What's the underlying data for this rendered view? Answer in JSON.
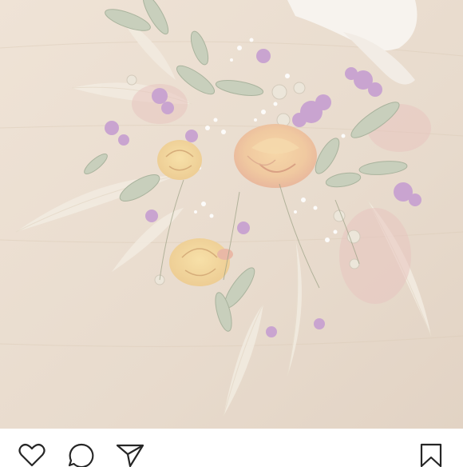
{
  "post": {
    "image_subject": "dried-flower-bouquet"
  },
  "actions": {
    "like_icon": "heart-outline-icon",
    "comment_icon": "speech-bubble-icon",
    "share_icon": "paper-plane-icon",
    "save_icon": "bookmark-outline-icon"
  },
  "colors": {
    "background_wood": "#e9ddd0",
    "icon_stroke": "#262626"
  }
}
